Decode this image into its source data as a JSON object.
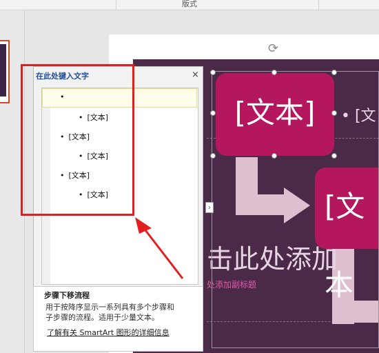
{
  "ribbon": {
    "group_label": "版式"
  },
  "text_pane": {
    "title": "在此处键入文字",
    "close_glyph": "×",
    "expand_glyph": "›",
    "items": [
      {
        "text": "",
        "level": 1
      },
      {
        "text": "[文本]",
        "level": 2
      },
      {
        "text": "[文本]",
        "level": 1
      },
      {
        "text": "[文本]",
        "level": 2
      },
      {
        "text": "[文本]",
        "level": 1
      },
      {
        "text": "[文本]",
        "level": 2
      }
    ],
    "bullet": "•"
  },
  "description": {
    "title": "步骤下移流程",
    "body_line1": "用于按降序显示一系列具有多个步骤和",
    "body_line2": "子步骤的流程。适用于少量文本。",
    "link": "了解有关 SmartArt 图形的详细信息"
  },
  "slide": {
    "box1_text": "[文本]",
    "box2_text": "[文本",
    "bullet_text": "• [文",
    "title_text": "击此处添加",
    "subtitle_text": "处添加副标题",
    "rotate_glyph": "⟳"
  },
  "colors": {
    "smartart_box": "#b5175f",
    "arrow": "#ddbfd0",
    "slide_bg": "#4a2a48",
    "annotation": "#e02020",
    "pane_title": "#1f4e9c"
  }
}
